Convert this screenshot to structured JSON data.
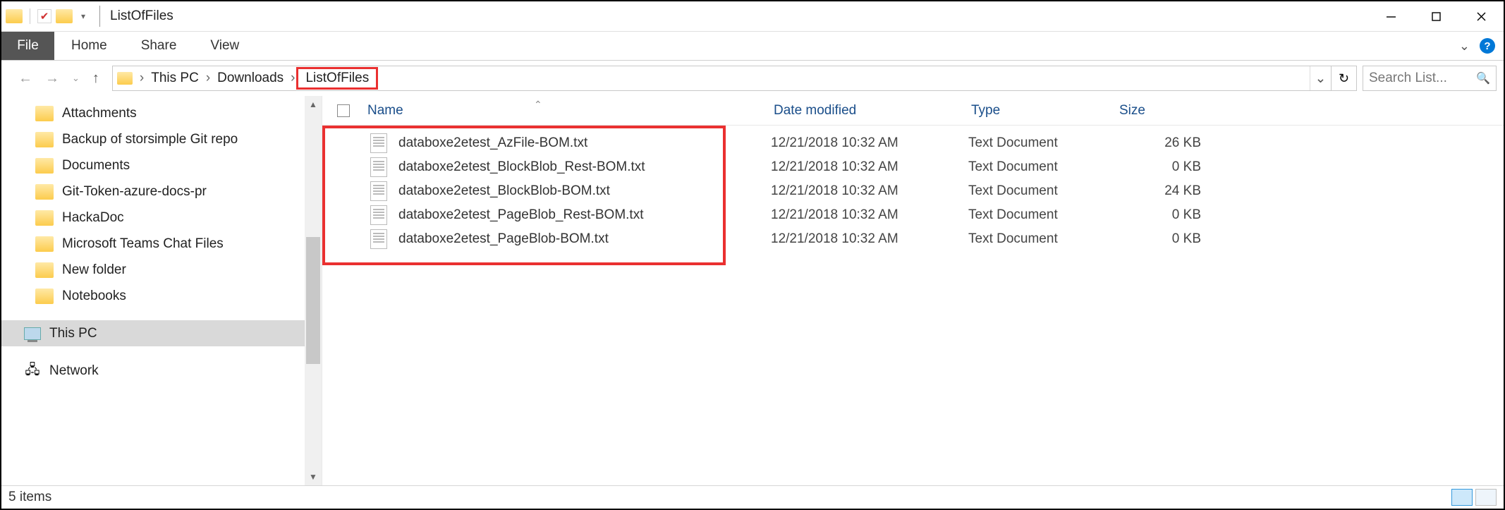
{
  "window": {
    "title": "ListOfFiles"
  },
  "ribbon": {
    "file": "File",
    "tabs": [
      "Home",
      "Share",
      "View"
    ]
  },
  "breadcrumb": {
    "items": [
      "This PC",
      "Downloads",
      "ListOfFiles"
    ],
    "highlighted_index": 2
  },
  "search": {
    "placeholder": "Search List..."
  },
  "sidebar": {
    "items": [
      {
        "label": "Attachments"
      },
      {
        "label": "Backup of storsimple Git repo"
      },
      {
        "label": "Documents"
      },
      {
        "label": "Git-Token-azure-docs-pr"
      },
      {
        "label": "HackaDoc"
      },
      {
        "label": "Microsoft Teams Chat Files"
      },
      {
        "label": "New folder"
      },
      {
        "label": "Notebooks"
      }
    ],
    "roots": [
      {
        "label": "This PC",
        "selected": true
      },
      {
        "label": "Network"
      }
    ]
  },
  "columns": {
    "name": "Name",
    "date": "Date modified",
    "type": "Type",
    "size": "Size"
  },
  "files": [
    {
      "name": "databoxe2etest_AzFile-BOM.txt",
      "date": "12/21/2018 10:32 AM",
      "type": "Text Document",
      "size": "26 KB"
    },
    {
      "name": "databoxe2etest_BlockBlob_Rest-BOM.txt",
      "date": "12/21/2018 10:32 AM",
      "type": "Text Document",
      "size": "0 KB"
    },
    {
      "name": "databoxe2etest_BlockBlob-BOM.txt",
      "date": "12/21/2018 10:32 AM",
      "type": "Text Document",
      "size": "24 KB"
    },
    {
      "name": "databoxe2etest_PageBlob_Rest-BOM.txt",
      "date": "12/21/2018 10:32 AM",
      "type": "Text Document",
      "size": "0 KB"
    },
    {
      "name": "databoxe2etest_PageBlob-BOM.txt",
      "date": "12/21/2018 10:32 AM",
      "type": "Text Document",
      "size": "0 KB"
    }
  ],
  "status": {
    "text": "5 items"
  }
}
